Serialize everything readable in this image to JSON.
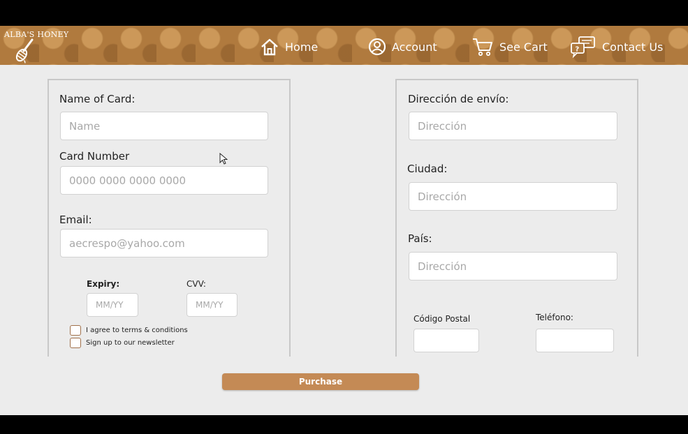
{
  "header": {
    "logo_text": "ALBA'S HONEY",
    "nav": [
      {
        "label": "Home",
        "icon": "home-icon"
      },
      {
        "label": "Account",
        "icon": "account-icon"
      },
      {
        "label": "See Cart",
        "icon": "cart-icon"
      },
      {
        "label": "Contact Us",
        "icon": "chat-icon"
      }
    ]
  },
  "payment": {
    "name_label": "Name of Card:",
    "name_placeholder": "Name",
    "card_label": "Card Number",
    "card_placeholder": "0000 0000 0000 0000",
    "email_label": "Email:",
    "email_placeholder": "aecrespo@yahoo.com",
    "expiry_label": "Expiry:",
    "expiry_placeholder": "MM/YY",
    "cvv_label": "CVV:",
    "cvv_placeholder": "MM/YY",
    "terms_label": "I agree to terms & conditions",
    "newsletter_label": "Sign up to our newsletter"
  },
  "shipping": {
    "address_label": "Dirección de envío:",
    "address_placeholder": "Dirección",
    "city_label": "Ciudad:",
    "city_placeholder": "Dirección",
    "country_label": "País:",
    "country_placeholder": "Dirección",
    "postal_label": "Código Postal",
    "phone_label": "Teléfono:"
  },
  "purchase_label": "Purchase",
  "colors": {
    "header": "#b07a3e",
    "button": "#c48a55",
    "background": "#ececec"
  }
}
